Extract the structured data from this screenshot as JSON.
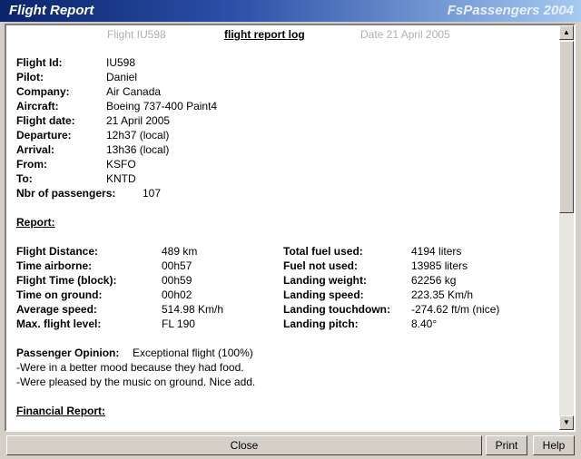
{
  "window": {
    "title": "Flight Report",
    "brand": "FsPassengers 2004"
  },
  "header": {
    "flight_label": "Flight IU598",
    "log_title": "flight report log",
    "date_label": "Date 21 April 2005"
  },
  "details": [
    {
      "label": "Flight Id:",
      "value": "IU598"
    },
    {
      "label": "Pilot:",
      "value": "Daniel"
    },
    {
      "label": "Company:",
      "value": "Air Canada"
    },
    {
      "label": "Aircraft:",
      "value": "Boeing 737-400 Paint4"
    },
    {
      "label": "Flight date:",
      "value": "21 April 2005"
    },
    {
      "label": "Departure:",
      "value": "12h37 (local)"
    },
    {
      "label": "Arrival:",
      "value": "13h36 (local)"
    },
    {
      "label": "From:",
      "value": "KSFO"
    },
    {
      "label": "To:",
      "value": "KNTD"
    },
    {
      "label": "Nbr of passengers:",
      "value": "107"
    }
  ],
  "report": {
    "heading": "Report:",
    "left": [
      {
        "label": "Flight Distance:",
        "value": "489 km"
      },
      {
        "label": "Time airborne:",
        "value": "00h57"
      },
      {
        "label": "Flight Time (block):",
        "value": "00h59"
      },
      {
        "label": "Time on ground:",
        "value": "00h02"
      },
      {
        "label": "Average speed:",
        "value": "514.98 Km/h"
      },
      {
        "label": "Max. flight level:",
        "value": "FL 190"
      }
    ],
    "right": [
      {
        "label": "Total fuel used:",
        "value": "4194 liters"
      },
      {
        "label": "Fuel not used:",
        "value": "13985 liters"
      },
      {
        "label": "Landing weight:",
        "value": "62256 kg"
      },
      {
        "label": "Landing speed:",
        "value": "223.35 Km/h"
      },
      {
        "label": "Landing touchdown:",
        "value": "-274.62 ft/m (nice)"
      },
      {
        "label": "Landing pitch:",
        "value": "8.40°"
      }
    ]
  },
  "opinion": {
    "label": "Passenger Opinion:",
    "value": "Exceptional flight (100%)",
    "notes": [
      "-Were in a better mood because they had food.",
      "-Were pleased by the music on ground. Nice add."
    ]
  },
  "financial": {
    "heading": "Financial Report:"
  },
  "buttons": {
    "close": "Close",
    "print": "Print",
    "help": "Help"
  }
}
